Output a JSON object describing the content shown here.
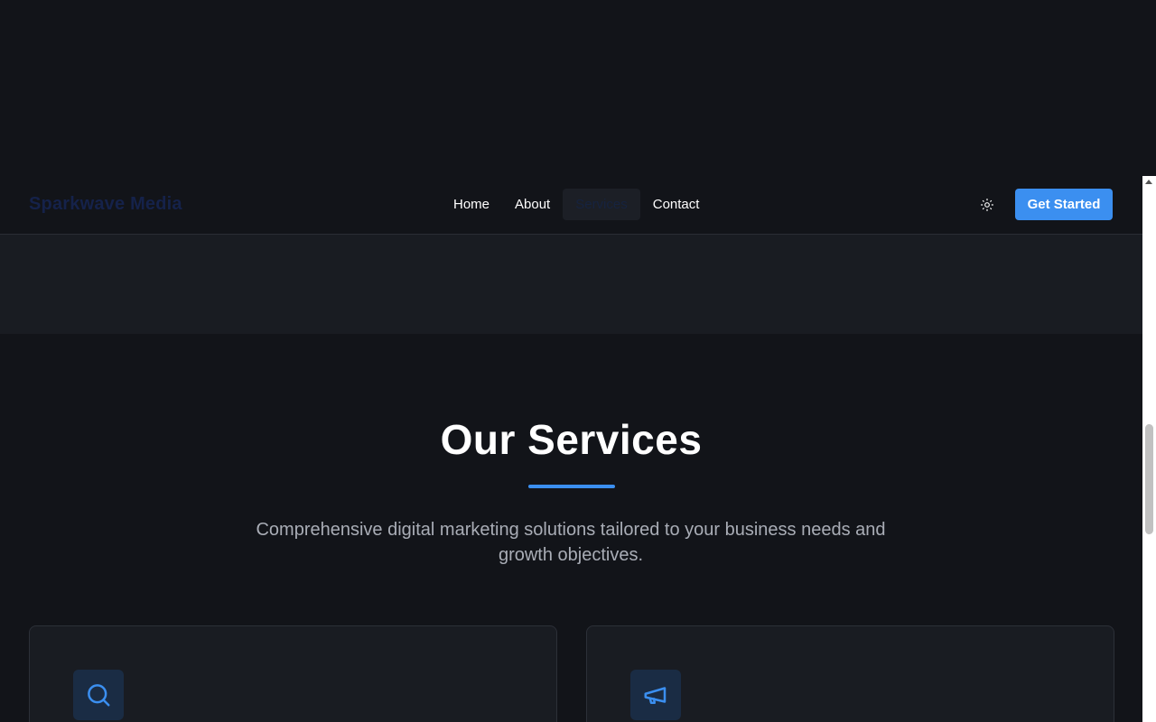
{
  "brand": {
    "logo_text": "Sparkwave Media"
  },
  "nav": {
    "links": [
      {
        "label": "Home"
      },
      {
        "label": "About"
      },
      {
        "label": "Services"
      },
      {
        "label": "Contact"
      }
    ],
    "active": "Services",
    "cta_label": "Get Started",
    "theme_icon": "sun-icon"
  },
  "services": {
    "title": "Our Services",
    "subtitle_line1": "Comprehensive digital marketing solutions tailored to your business needs and",
    "subtitle_line2": "growth objectives.",
    "cards": [
      {
        "icon": "search-icon"
      },
      {
        "icon": "megaphone-icon"
      }
    ]
  },
  "colors": {
    "background": "#121419",
    "accent": "#3b8ff0",
    "card_bg": "#191c22"
  }
}
